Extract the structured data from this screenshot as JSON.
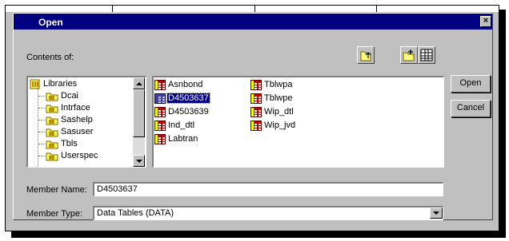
{
  "dialog": {
    "title": "Open",
    "close_glyph": "×"
  },
  "contents_label": "Contents of:",
  "toolbar": {
    "icons": [
      "up-folder-icon",
      "new-folder-icon",
      "details-view-icon"
    ]
  },
  "tree": {
    "items": [
      {
        "label": "Libraries",
        "icon": "library-folder-icon"
      },
      {
        "label": "Dcai",
        "icon": "library-icon"
      },
      {
        "label": "Intrface",
        "icon": "library-icon"
      },
      {
        "label": "Sashelp",
        "icon": "library-icon"
      },
      {
        "label": "Sasuser",
        "icon": "library-icon"
      },
      {
        "label": "Tbls",
        "icon": "library-icon"
      },
      {
        "label": "Userspec",
        "icon": "library-icon"
      }
    ]
  },
  "files": {
    "col1": [
      "Asnbond",
      "D4503637",
      "D4503639",
      "Ind_dtl",
      "Labtran"
    ],
    "col2": [
      "Tblwpa",
      "Tblwpe",
      "Wip_dtl",
      "Wip_jvd"
    ],
    "selected": "D4503637"
  },
  "buttons": {
    "open": "Open",
    "cancel": "Cancel"
  },
  "member_name": {
    "label": "Member Name:",
    "value": "D4503637"
  },
  "member_type": {
    "label": "Member Type:",
    "value": "Data Tables (DATA)"
  },
  "colors": {
    "titlebar": "#000080",
    "face": "#c0c0c0",
    "selection": "#000080"
  }
}
